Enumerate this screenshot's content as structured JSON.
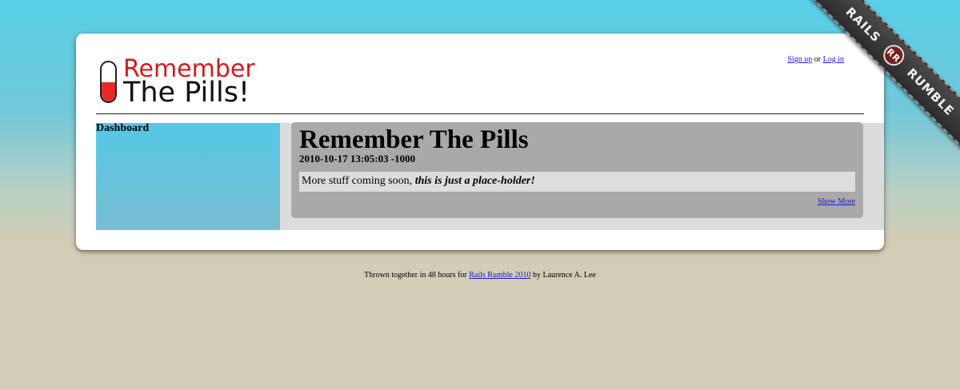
{
  "logo": {
    "line1": "Remember",
    "line2": "The Pills!",
    "accent_color": "#cf1d1d"
  },
  "auth": {
    "signup_label": "Sign up",
    "separator": "or",
    "login_label": "Log in"
  },
  "sidebar": {
    "title": "Dashboard"
  },
  "post": {
    "title": "Remember The Pills",
    "timestamp": "2010-10-17 13:05:03 -1000",
    "body_prefix": "More stuff coming soon, ",
    "body_emphasis": "this is just a place-holder!",
    "show_more_label": "Show More"
  },
  "footer": {
    "prefix": "Thrown together in 48 hours for ",
    "link_label": "Rails Rumble 2010",
    "suffix": " by Laurence A. Lee"
  },
  "ribbon": {
    "left_text": "RAILS",
    "badge_text": "RR",
    "right_text": "RUMBLE"
  }
}
